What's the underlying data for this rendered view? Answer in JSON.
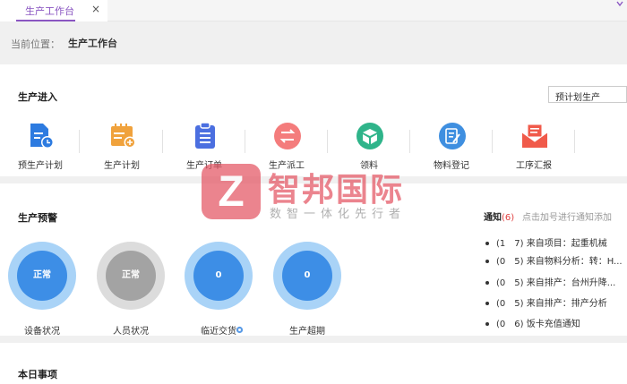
{
  "tabbar": {
    "tab_label": "生产工作台",
    "close_glyph": "×"
  },
  "breadcrumb": {
    "label": "当前位置：",
    "value": "生产工作台"
  },
  "production_entry": {
    "title": "生产进入",
    "select_value": "预计划生产",
    "items": [
      {
        "label": "预生产计划",
        "icon": "document-clock-icon",
        "color": "#2d7be0"
      },
      {
        "label": "生产计划",
        "icon": "calendar-plus-icon",
        "color": "#f0a23c"
      },
      {
        "label": "生产订单",
        "icon": "clipboard-icon",
        "color": "#4b6fe0"
      },
      {
        "label": "生产派工",
        "icon": "swap-arrows-icon",
        "color": "#f47c7c"
      },
      {
        "label": "领料",
        "icon": "box-icon",
        "color": "#2fb48a"
      },
      {
        "label": "物料登记",
        "icon": "edit-note-icon",
        "color": "#3f8fe0"
      },
      {
        "label": "工序汇报",
        "icon": "mail-icon",
        "color": "#f05a4a"
      }
    ]
  },
  "production_warning": {
    "title": "生产预警",
    "items": [
      {
        "value": "正常",
        "label": "设备状况",
        "ring_color": "#a9d3f7",
        "inner_color": "#3d8ee6"
      },
      {
        "value": "正常",
        "label": "人员状况",
        "ring_color": "#dcdcdc",
        "inner_color": "#a3a3a3"
      },
      {
        "value": "0",
        "label": "临近交货",
        "ring_color": "#a9d3f7",
        "inner_color": "#3d8ee6"
      },
      {
        "value": "0",
        "label": "生产超期",
        "ring_color": "#a9d3f7",
        "inner_color": "#3d8ee6"
      }
    ]
  },
  "notice": {
    "title": "通知",
    "count": "(6)",
    "hint": "点击加号进行通知添加",
    "items": [
      "(1　7) 来自项目：起重机械",
      "(0　5) 来自物料分析：转：H...",
      "(0　5) 来自排产：台州升降...",
      "(0　5) 来自排产：排产分析",
      "(0　6) 饭卡充值通知"
    ]
  },
  "today": {
    "title": "本日事项"
  },
  "watermark": {
    "letter": "Z",
    "main": "智邦国际",
    "sub": "数智一体化先行者"
  },
  "colors": {
    "accent": "#8a56c2",
    "brand_red": "#e45664"
  }
}
